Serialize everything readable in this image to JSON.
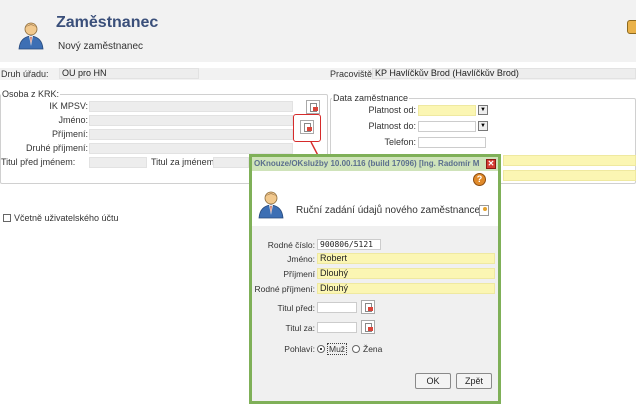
{
  "header": {
    "title": "Zaměstnanec",
    "subtitle": "Nový zaměstnanec"
  },
  "row1": {
    "druh_uradu_label": "Druh úřadu:",
    "druh_uradu_value": "OÚ pro HN",
    "pracoviste_label": "Pracoviště:",
    "pracoviste_value": "KP Havlíčkův Brod (Havlíčkův Brod)"
  },
  "osoba": {
    "group_title": "Osoba z KRK:",
    "ik_mpsv_label": "IK MPSV:",
    "jmeno_label": "Jméno:",
    "prijmeni_label": "Příjmení:",
    "druhe_prijmeni_label": "Druhé příjmení:",
    "titul_pred_label": "Titul před jménem:",
    "titul_za_label": "Titul za jménem:"
  },
  "data_zamestnance": {
    "group_title": "Data zaměstnance",
    "platnost_od_label": "Platnost od:",
    "platnost_do_label": "Platnost do:",
    "telefon_label": "Telefon:",
    "combo_arrow": "▼"
  },
  "checkbox_label": "Včetně uživatelského účtu",
  "dialog": {
    "title": "OKnouze/OKslužby 10.00.116 (build 17096) [Ing. Radomír M",
    "close_glyph": "✕",
    "help_glyph": "?",
    "heading": "Ruční zadání údajů nového zaměstnance",
    "fields": {
      "rodne_cislo_label": "Rodné číslo:",
      "rodne_cislo_value": "900806/5121",
      "jmeno_label": "Jméno:",
      "jmeno_value": "Robert",
      "prijmeni_label": "Příjmení",
      "prijmeni_value": "Dlouhý",
      "rodne_prijmeni_label": "Rodné příjmení:",
      "rodne_prijmeni_value": "Dlouhý",
      "titul_pred_label": "Titul před:",
      "titul_za_label": "Titul za:",
      "pohlavi_label": "Pohlaví:",
      "muz_label": "Muž",
      "zena_label": "Žena"
    },
    "ok_button": "OK",
    "zpet_button": "Zpět"
  },
  "colors": {
    "dialog_border": "#7fb058",
    "dialog_titlebar": "#cfe3ba",
    "required_field": "#fbf6b3",
    "annotation_red": "#d62b2b",
    "title_blue": "#3a4f7a"
  }
}
